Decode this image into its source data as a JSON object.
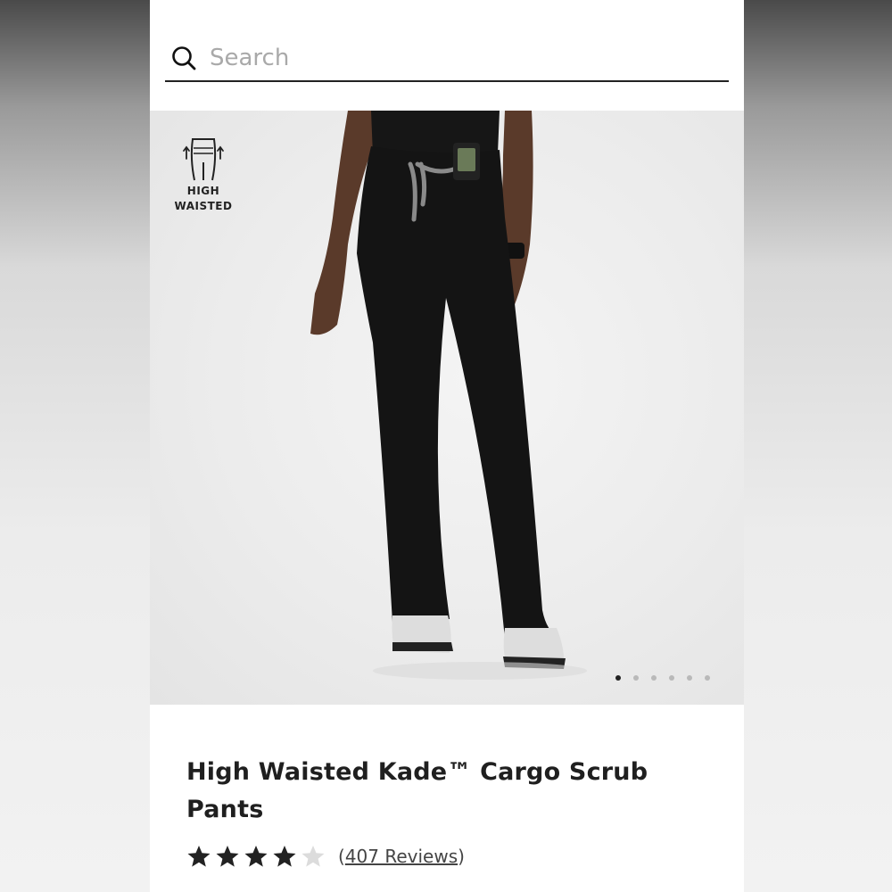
{
  "search": {
    "placeholder": "Search",
    "value": ""
  },
  "badge": {
    "icon": "high-waist-icon",
    "line1": "HIGH",
    "line2": "WAISTED"
  },
  "carousel": {
    "slide_count": 6,
    "active_index": 0
  },
  "product": {
    "title_line1": "High Waisted Kade™ Cargo Scrub",
    "title_line2": "Pants",
    "rating_stars": 4,
    "rating_max": 5,
    "reviews_open": "(",
    "reviews_text": "407 Reviews",
    "reviews_close": ")"
  },
  "colors": {
    "star_filled": "#222222",
    "star_empty": "#dcdcdc",
    "pants": "#141414"
  }
}
